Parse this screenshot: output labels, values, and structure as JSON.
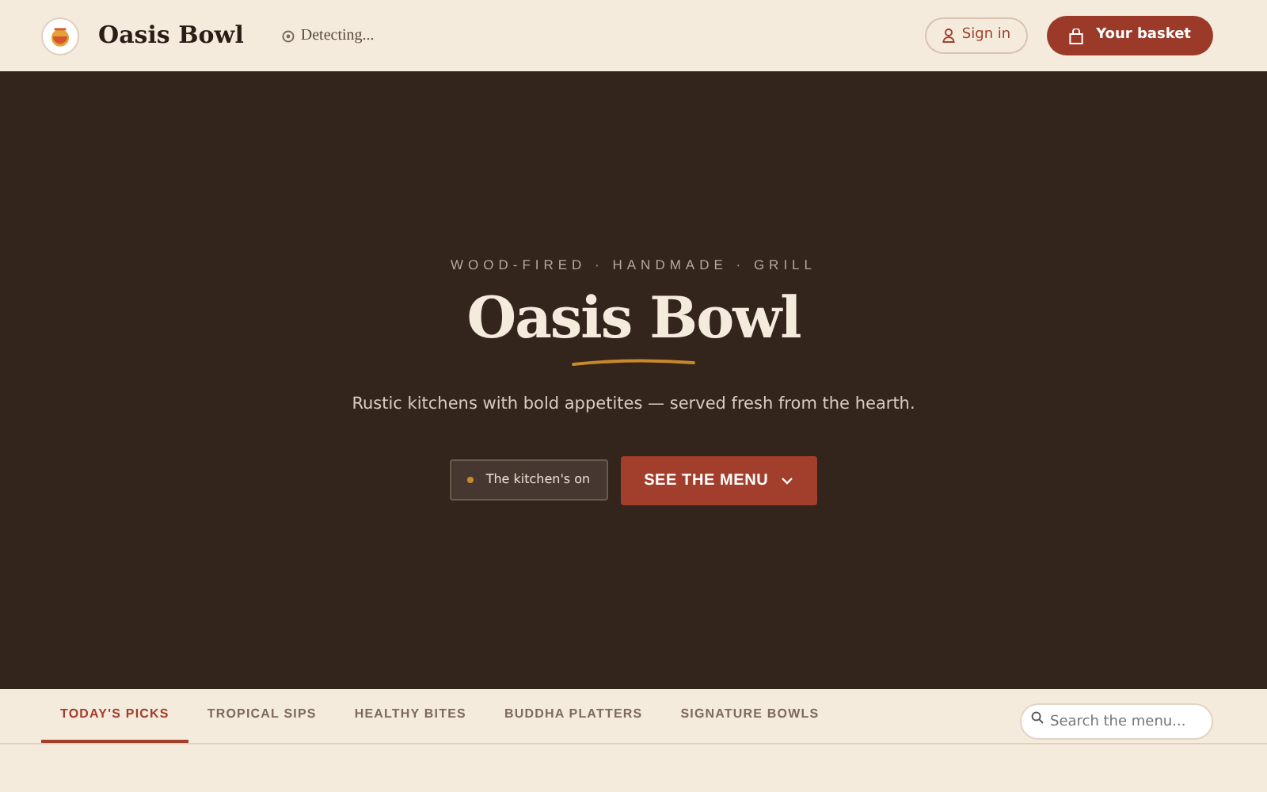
{
  "header": {
    "brand": "Oasis Bowl",
    "location": "Detecting...",
    "sign_in": "Sign in",
    "basket": "Your basket"
  },
  "hero": {
    "eyebrow": "WOOD-FIRED · HANDMADE · GRILL",
    "title": "Oasis Bowl",
    "tagline": "Rustic kitchens with bold appetites — served fresh from the hearth.",
    "status": {
      "label": "The kitchen's on",
      "color": "#c8892a"
    },
    "cta": "SEE THE MENU"
  },
  "tabs": [
    {
      "label": "TODAY'S PICKS",
      "selected": true
    },
    {
      "label": "TROPICAL SIPS",
      "selected": false
    },
    {
      "label": "HEALTHY BITES",
      "selected": false
    },
    {
      "label": "BUDDHA PLATTERS",
      "selected": false
    },
    {
      "label": "SIGNATURE BOWLS",
      "selected": false
    }
  ],
  "search": {
    "placeholder": "Search the menu..."
  }
}
